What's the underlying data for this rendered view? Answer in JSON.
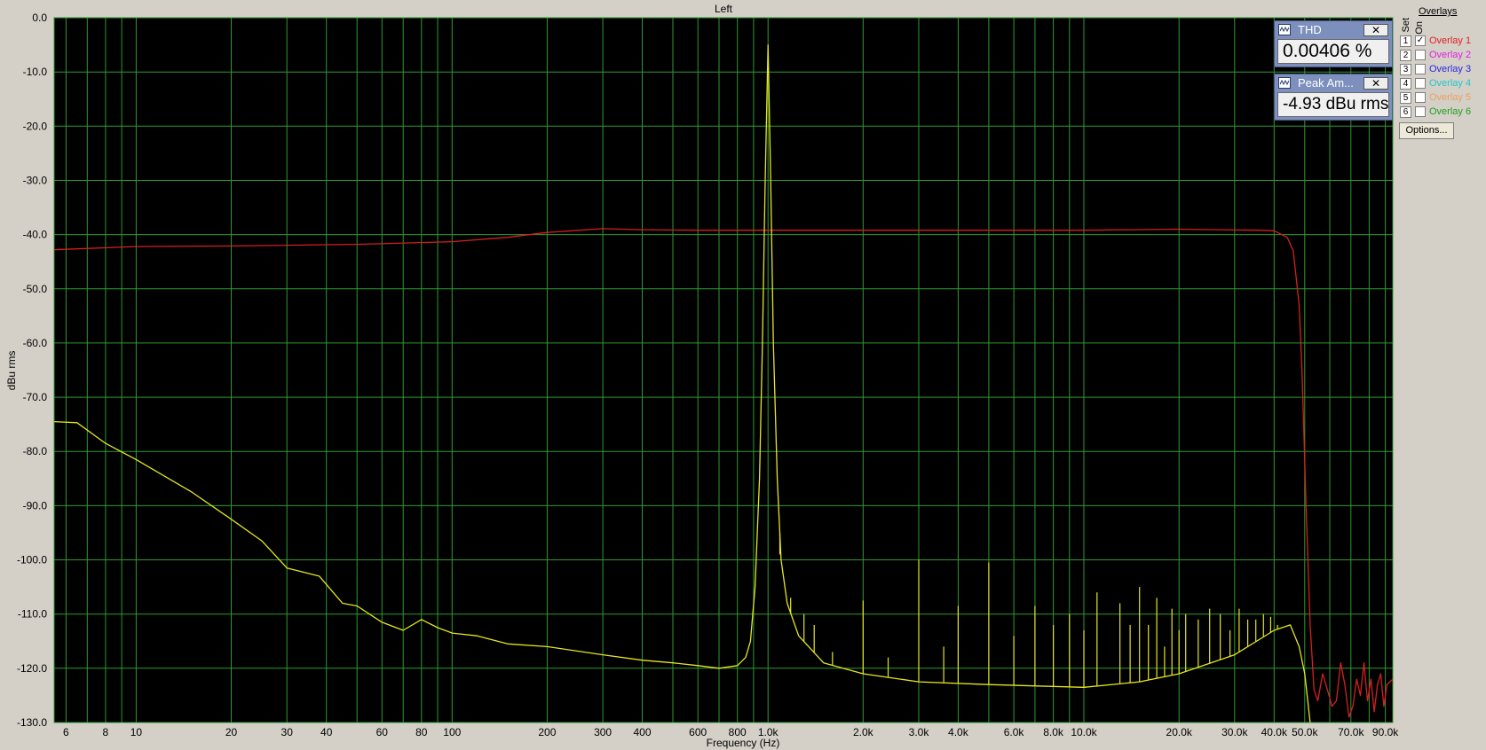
{
  "chart_data": {
    "type": "line",
    "title": "Left",
    "xlabel": "Frequency (Hz)",
    "ylabel": "dBu rms",
    "x_scale": "log",
    "xlim": [
      5.5,
      95000
    ],
    "ylim": [
      -130,
      0
    ],
    "y_ticks": [
      "0.0",
      "-10.0",
      "-20.0",
      "-30.0",
      "-40.0",
      "-50.0",
      "-60.0",
      "-70.0",
      "-80.0",
      "-90.0",
      "-100.0",
      "-110.0",
      "-120.0",
      "-130.0"
    ],
    "x_ticks": [
      {
        "label": "6",
        "value": 6
      },
      {
        "label": "8",
        "value": 8
      },
      {
        "label": "10",
        "value": 10
      },
      {
        "label": "20",
        "value": 20
      },
      {
        "label": "30",
        "value": 30
      },
      {
        "label": "40",
        "value": 40
      },
      {
        "label": "60",
        "value": 60
      },
      {
        "label": "80",
        "value": 80
      },
      {
        "label": "100",
        "value": 100
      },
      {
        "label": "200",
        "value": 200
      },
      {
        "label": "300",
        "value": 300
      },
      {
        "label": "400",
        "value": 400
      },
      {
        "label": "600",
        "value": 600
      },
      {
        "label": "800",
        "value": 800
      },
      {
        "label": "1.0k",
        "value": 1000
      },
      {
        "label": "2.0k",
        "value": 2000
      },
      {
        "label": "3.0k",
        "value": 3000
      },
      {
        "label": "4.0k",
        "value": 4000
      },
      {
        "label": "6.0k",
        "value": 6000
      },
      {
        "label": "8.0k",
        "value": 8000
      },
      {
        "label": "10.0k",
        "value": 10000
      },
      {
        "label": "20.0k",
        "value": 20000
      },
      {
        "label": "30.0k",
        "value": 30000
      },
      {
        "label": "40.0k",
        "value": 40000
      },
      {
        "label": "50.0k",
        "value": 50000
      },
      {
        "label": "70.0k",
        "value": 70000
      },
      {
        "label": "90.0k",
        "value": 90000
      }
    ],
    "grid": true,
    "colors": {
      "background": "#000000",
      "grid": "#2f9a2f",
      "plot_border": "#2f9a2f",
      "frame": "#d4d0c8"
    },
    "series": [
      {
        "color": "#d42020",
        "points": [
          [
            5.5,
            -42.8
          ],
          [
            10,
            -42.2
          ],
          [
            20,
            -42.1
          ],
          [
            50,
            -41.8
          ],
          [
            100,
            -41.3
          ],
          [
            150,
            -40.5
          ],
          [
            200,
            -39.6
          ],
          [
            300,
            -38.9
          ],
          [
            400,
            -39.1
          ],
          [
            600,
            -39.2
          ],
          [
            1000,
            -39.2
          ],
          [
            5000,
            -39.2
          ],
          [
            10000,
            -39.2
          ],
          [
            20000,
            -39.0
          ],
          [
            35000,
            -39.2
          ],
          [
            40000,
            -39.3
          ],
          [
            44000,
            -40.5
          ],
          [
            46000,
            -43
          ],
          [
            48000,
            -53
          ],
          [
            49000,
            -65
          ],
          [
            50500,
            -90
          ],
          [
            52000,
            -112
          ],
          [
            53500,
            -124
          ],
          [
            55000,
            -126
          ],
          [
            57000,
            -121
          ],
          [
            59000,
            -124
          ],
          [
            61000,
            -127
          ],
          [
            63000,
            -126
          ],
          [
            65000,
            -119
          ],
          [
            67000,
            -123
          ],
          [
            69000,
            -129
          ],
          [
            71000,
            -127
          ],
          [
            73000,
            -122
          ],
          [
            75000,
            -125
          ],
          [
            77000,
            -119
          ],
          [
            79000,
            -126
          ],
          [
            81000,
            -122
          ],
          [
            83000,
            -128
          ],
          [
            85000,
            -123
          ],
          [
            87000,
            -121
          ],
          [
            89000,
            -127
          ],
          [
            91000,
            -123
          ],
          [
            95000,
            -122
          ]
        ]
      },
      {
        "color": "#e6e621",
        "points": [
          [
            5.5,
            -74.5
          ],
          [
            6.5,
            -74.7
          ],
          [
            8,
            -78.5
          ],
          [
            10,
            -81.5
          ],
          [
            15,
            -87.5
          ],
          [
            20,
            -92.5
          ],
          [
            25,
            -96.5
          ],
          [
            30,
            -101.5
          ],
          [
            38,
            -103
          ],
          [
            45,
            -108
          ],
          [
            50,
            -108.5
          ],
          [
            60,
            -111.5
          ],
          [
            70,
            -113
          ],
          [
            80,
            -111
          ],
          [
            90,
            -112.5
          ],
          [
            100,
            -113.5
          ],
          [
            120,
            -114
          ],
          [
            150,
            -115.5
          ],
          [
            200,
            -116
          ],
          [
            300,
            -117.5
          ],
          [
            400,
            -118.5
          ],
          [
            500,
            -119
          ],
          [
            600,
            -119.5
          ],
          [
            700,
            -120
          ],
          [
            800,
            -119.5
          ],
          [
            850,
            -118
          ],
          [
            880,
            -115
          ],
          [
            910,
            -105
          ],
          [
            940,
            -85
          ],
          [
            960,
            -60
          ],
          [
            980,
            -30
          ],
          [
            1000,
            -5
          ],
          [
            1020,
            -30
          ],
          [
            1040,
            -60
          ],
          [
            1070,
            -85
          ],
          [
            1100,
            -100
          ],
          [
            1150,
            -108
          ],
          [
            1250,
            -114
          ],
          [
            1500,
            -119
          ],
          [
            2000,
            -121
          ],
          [
            3000,
            -122.5
          ],
          [
            5000,
            -123
          ],
          [
            10000,
            -123.5
          ],
          [
            15000,
            -122.5
          ],
          [
            20000,
            -121
          ],
          [
            30000,
            -117.5
          ],
          [
            40000,
            -113
          ],
          [
            45000,
            -112
          ],
          [
            48000,
            -116
          ],
          [
            50000,
            -121
          ],
          [
            52000,
            -130
          ]
        ]
      }
    ],
    "harmonics": [
      {
        "f": 1090,
        "db": -99
      },
      {
        "f": 1180,
        "db": -107
      },
      {
        "f": 1300,
        "db": -110
      },
      {
        "f": 1400,
        "db": -112
      },
      {
        "f": 1600,
        "db": -117
      },
      {
        "f": 2000,
        "db": -107.5
      },
      {
        "f": 2400,
        "db": -118
      },
      {
        "f": 3000,
        "db": -100
      },
      {
        "f": 3600,
        "db": -116
      },
      {
        "f": 4000,
        "db": -108.5
      },
      {
        "f": 5000,
        "db": -100.5
      },
      {
        "f": 6000,
        "db": -114
      },
      {
        "f": 7000,
        "db": -108.5
      },
      {
        "f": 8000,
        "db": -112
      },
      {
        "f": 9000,
        "db": -110
      },
      {
        "f": 10000,
        "db": -113
      },
      {
        "f": 11000,
        "db": -106
      },
      {
        "f": 13000,
        "db": -108
      },
      {
        "f": 14000,
        "db": -112
      },
      {
        "f": 15000,
        "db": -105
      },
      {
        "f": 16000,
        "db": -112
      },
      {
        "f": 17000,
        "db": -107
      },
      {
        "f": 18000,
        "db": -116
      },
      {
        "f": 19000,
        "db": -109
      },
      {
        "f": 20000,
        "db": -113
      },
      {
        "f": 21000,
        "db": -110
      },
      {
        "f": 23000,
        "db": -111
      },
      {
        "f": 25000,
        "db": -109
      },
      {
        "f": 27000,
        "db": -110
      },
      {
        "f": 29000,
        "db": -113
      },
      {
        "f": 31000,
        "db": -109
      },
      {
        "f": 33000,
        "db": -111
      },
      {
        "f": 35000,
        "db": -111
      },
      {
        "f": 37000,
        "db": -110
      },
      {
        "f": 39000,
        "db": -110.5
      },
      {
        "f": 41000,
        "db": -112
      }
    ]
  },
  "meters": {
    "thd": {
      "title": "THD",
      "value": "0.00406 %",
      "close": "✕"
    },
    "peak": {
      "title": "Peak Am...",
      "value": "-4.93 dBu rms",
      "close": "✕"
    }
  },
  "overlays": {
    "header": "Overlays",
    "set_label": "Set",
    "on_label": "On",
    "options_label": "Options...",
    "items": [
      {
        "num": "1",
        "label": "Overlay 1",
        "checked": true,
        "check_mark": "✓",
        "color": "#e02020"
      },
      {
        "num": "2",
        "label": "Overlay 2",
        "checked": false,
        "check_mark": "",
        "color": "#e020e0"
      },
      {
        "num": "3",
        "label": "Overlay 3",
        "checked": false,
        "check_mark": "",
        "color": "#2828e0"
      },
      {
        "num": "4",
        "label": "Overlay 4",
        "checked": false,
        "check_mark": "",
        "color": "#20c8c8"
      },
      {
        "num": "5",
        "label": "Overlay 5",
        "checked": false,
        "check_mark": "",
        "color": "#e8a060"
      },
      {
        "num": "6",
        "label": "Overlay 6",
        "checked": false,
        "check_mark": "",
        "color": "#20a020"
      }
    ]
  }
}
